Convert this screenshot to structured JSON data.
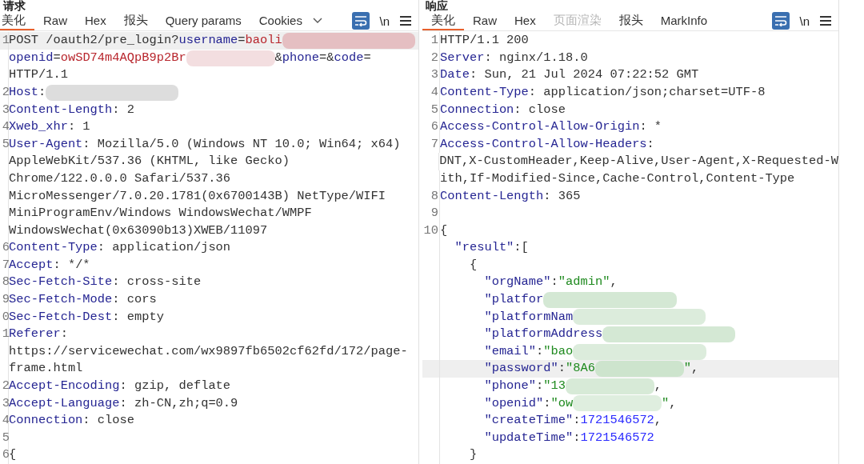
{
  "panels": [
    {
      "title": "请求",
      "tabs": [
        {
          "label": "美化",
          "selected": true,
          "disabled": false
        },
        {
          "label": "Raw",
          "selected": false,
          "disabled": false
        },
        {
          "label": "Hex",
          "selected": false,
          "disabled": false
        },
        {
          "label": "报头",
          "selected": false,
          "disabled": false
        },
        {
          "label": "Query params",
          "selected": false,
          "disabled": false
        },
        {
          "label": "Cookies",
          "selected": false,
          "disabled": false
        }
      ],
      "more_tabs": true,
      "tools": {
        "wrap_selected": true,
        "newline": "\\n"
      },
      "lines": [
        {
          "num": "1",
          "highlighted": true,
          "segments": [
            {
              "kind": "plain",
              "text": "POST /oauth2/pre_login?"
            },
            {
              "kind": "key",
              "text": "username"
            },
            {
              "kind": "plain",
              "text": "="
            },
            {
              "kind": "value",
              "text": "baoli"
            },
            {
              "kind": "redacted",
              "color": "#e3b9bd"
            }
          ]
        },
        {
          "highlighted": false,
          "segments": [
            {
              "kind": "key",
              "text": "openid"
            },
            {
              "kind": "plain",
              "text": "="
            },
            {
              "kind": "value",
              "text": "owSD74m4AQpB9p2Br"
            },
            {
              "kind": "redacted",
              "color": "#f2dadd"
            },
            {
              "kind": "plain",
              "text": "&"
            },
            {
              "kind": "key",
              "text": "phone"
            },
            {
              "kind": "plain",
              "text": "=&"
            },
            {
              "kind": "key",
              "text": "code"
            },
            {
              "kind": "plain",
              "text": "="
            }
          ]
        },
        {
          "highlighted": false,
          "segments": [
            {
              "kind": "plain",
              "text": "HTTP/1.1"
            }
          ]
        },
        {
          "num": "2",
          "highlighted": false,
          "segments": [
            {
              "kind": "key",
              "text": "Host"
            },
            {
              "kind": "plain",
              "text": ":"
            },
            {
              "kind": "redacted",
              "color": "#d9d9d9"
            }
          ]
        },
        {
          "num": "3",
          "highlighted": false,
          "segments": [
            {
              "kind": "key",
              "text": "Content-Length"
            },
            {
              "kind": "plain",
              "text": ": 2"
            }
          ]
        },
        {
          "num": "4",
          "highlighted": false,
          "segments": [
            {
              "kind": "key",
              "text": "Xweb_xhr"
            },
            {
              "kind": "plain",
              "text": ": 1"
            }
          ]
        },
        {
          "num": "5",
          "highlighted": false,
          "segments": [
            {
              "kind": "key",
              "text": "User-Agent"
            },
            {
              "kind": "plain",
              "text": ": Mozilla/5.0 (Windows NT 10.0; Win64; x64)"
            }
          ]
        },
        {
          "highlighted": false,
          "segments": [
            {
              "kind": "plain",
              "text": "AppleWebKit/537.36 (KHTML, like Gecko)"
            }
          ]
        },
        {
          "highlighted": false,
          "segments": [
            {
              "kind": "plain",
              "text": "Chrome/122.0.0.0 Safari/537.36"
            }
          ]
        },
        {
          "highlighted": false,
          "segments": [
            {
              "kind": "plain",
              "text": "MicroMessenger/7.0.20.1781(0x6700143B) NetType/WIFI"
            }
          ]
        },
        {
          "highlighted": false,
          "segments": [
            {
              "kind": "plain",
              "text": "MiniProgramEnv/Windows WindowsWechat/WMPF"
            }
          ]
        },
        {
          "highlighted": false,
          "segments": [
            {
              "kind": "plain",
              "text": "WindowsWechat(0x63090b13)XWEB/11097"
            }
          ]
        },
        {
          "num": "6",
          "highlighted": false,
          "segments": [
            {
              "kind": "key",
              "text": "Content-Type"
            },
            {
              "kind": "plain",
              "text": ": application/json"
            }
          ]
        },
        {
          "num": "7",
          "highlighted": false,
          "segments": [
            {
              "kind": "key",
              "text": "Accept"
            },
            {
              "kind": "plain",
              "text": ": */*"
            }
          ]
        },
        {
          "num": "8",
          "highlighted": false,
          "segments": [
            {
              "kind": "key",
              "text": "Sec-Fetch-Site"
            },
            {
              "kind": "plain",
              "text": ": cross-site"
            }
          ]
        },
        {
          "num": "9",
          "highlighted": false,
          "segments": [
            {
              "kind": "key",
              "text": "Sec-Fetch-Mode"
            },
            {
              "kind": "plain",
              "text": ": cors"
            }
          ]
        },
        {
          "num": "0",
          "highlighted": false,
          "segments": [
            {
              "kind": "key",
              "text": "Sec-Fetch-Dest"
            },
            {
              "kind": "plain",
              "text": ": empty"
            }
          ]
        },
        {
          "num": "1",
          "highlighted": false,
          "segments": [
            {
              "kind": "key",
              "text": "Referer"
            },
            {
              "kind": "plain",
              "text": ":"
            }
          ]
        },
        {
          "highlighted": false,
          "segments": [
            {
              "kind": "plain",
              "text": "https://servicewechat.com/wx9897fb6502cf62fd/172/page-"
            }
          ]
        },
        {
          "highlighted": false,
          "segments": [
            {
              "kind": "plain",
              "text": "frame.html"
            }
          ]
        },
        {
          "num": "2",
          "highlighted": false,
          "segments": [
            {
              "kind": "key",
              "text": "Accept-Encoding"
            },
            {
              "kind": "plain",
              "text": ": gzip, deflate"
            }
          ]
        },
        {
          "num": "3",
          "highlighted": false,
          "segments": [
            {
              "kind": "key",
              "text": "Accept-Language"
            },
            {
              "kind": "plain",
              "text": ": zh-CN,zh;q=0.9"
            }
          ]
        },
        {
          "num": "4",
          "highlighted": false,
          "segments": [
            {
              "kind": "key",
              "text": "Connection"
            },
            {
              "kind": "plain",
              "text": ": close"
            }
          ]
        },
        {
          "num": "5",
          "highlighted": false
        },
        {
          "num": "6",
          "highlighted": false,
          "segments": [
            {
              "kind": "plain",
              "text": "{"
            }
          ]
        }
      ]
    },
    {
      "title": "响应",
      "tabs": [
        {
          "label": "美化",
          "selected": true,
          "disabled": false
        },
        {
          "label": "Raw",
          "selected": false,
          "disabled": false
        },
        {
          "label": "Hex",
          "selected": false,
          "disabled": false
        },
        {
          "label": "页面渲染",
          "selected": false,
          "disabled": true
        },
        {
          "label": "报头",
          "selected": false,
          "disabled": false
        },
        {
          "label": "MarkInfo",
          "selected": false,
          "disabled": false
        }
      ],
      "more_tabs": false,
      "tools": {
        "wrap_selected": true,
        "newline": "\\n"
      },
      "lines": [
        {
          "num": "1",
          "highlighted": false,
          "segments": [
            {
              "kind": "plain",
              "text": "HTTP/1.1 200"
            }
          ]
        },
        {
          "num": "2",
          "highlighted": false,
          "segments": [
            {
              "kind": "key",
              "text": "Server"
            },
            {
              "kind": "plain",
              "text": ": nginx/1.18.0"
            }
          ]
        },
        {
          "num": "3",
          "highlighted": false,
          "segments": [
            {
              "kind": "key",
              "text": "Date"
            },
            {
              "kind": "plain",
              "text": ": Sun, 21 Jul 2024 07:22:52 GMT"
            }
          ]
        },
        {
          "num": "4",
          "highlighted": false,
          "segments": [
            {
              "kind": "key",
              "text": "Content-Type"
            },
            {
              "kind": "plain",
              "text": ": application/json;charset=UTF-8"
            }
          ]
        },
        {
          "num": "5",
          "highlighted": false,
          "segments": [
            {
              "kind": "key",
              "text": "Connection"
            },
            {
              "kind": "plain",
              "text": ": close"
            }
          ]
        },
        {
          "num": "6",
          "highlighted": false,
          "segments": [
            {
              "kind": "key",
              "text": "Access-Control-Allow-Origin"
            },
            {
              "kind": "plain",
              "text": ": *"
            }
          ]
        },
        {
          "num": "7",
          "highlighted": false,
          "segments": [
            {
              "kind": "key",
              "text": "Access-Control-Allow-Headers"
            },
            {
              "kind": "plain",
              "text": ":"
            }
          ]
        },
        {
          "highlighted": false,
          "segments": [
            {
              "kind": "plain",
              "text": "DNT,X-CustomHeader,Keep-Alive,User-Agent,X-Requested-W"
            }
          ]
        },
        {
          "highlighted": false,
          "segments": [
            {
              "kind": "plain",
              "text": "ith,If-Modified-Since,Cache-Control,Content-Type"
            }
          ]
        },
        {
          "num": "8",
          "highlighted": false,
          "segments": [
            {
              "kind": "key",
              "text": "Content-Length"
            },
            {
              "kind": "plain",
              "text": ": 365"
            }
          ]
        },
        {
          "num": "9",
          "highlighted": false
        },
        {
          "num": "10",
          "highlighted": false,
          "segments": [
            {
              "kind": "plain",
              "text": "{"
            }
          ]
        },
        {
          "highlighted": false,
          "kind": "depth1",
          "segments": [
            {
              "kind": "key",
              "text": "\"result\""
            },
            {
              "kind": "plain",
              "text": ":["
            }
          ]
        },
        {
          "highlighted": false,
          "kind": "depth2",
          "segments": [
            {
              "kind": "plain",
              "text": "{"
            }
          ]
        },
        {
          "highlighted": false,
          "kind": "depth3",
          "segments": [
            {
              "kind": "key",
              "text": "\"orgName\""
            },
            {
              "kind": "plain",
              "text": ":"
            },
            {
              "kind": "string",
              "text": "\"admin\""
            },
            {
              "kind": "plain",
              "text": ","
            }
          ]
        },
        {
          "highlighted": false,
          "kind": "depth3",
          "segments": [
            {
              "kind": "key",
              "text": "\"platfor"
            },
            {
              "kind": "redacted",
              "color": "#cfe5cf"
            }
          ]
        },
        {
          "highlighted": false,
          "kind": "depth3",
          "segments": [
            {
              "kind": "key",
              "text": "\"platformNam"
            },
            {
              "kind": "redacted",
              "color": "#d8ead8"
            }
          ]
        },
        {
          "highlighted": false,
          "kind": "depth3",
          "segments": [
            {
              "kind": "key",
              "text": "\"platformAddress"
            },
            {
              "kind": "redacted",
              "color": "#cfe5cf"
            }
          ]
        },
        {
          "highlighted": false,
          "kind": "depth3",
          "segments": [
            {
              "kind": "key",
              "text": "\"email\""
            },
            {
              "kind": "plain",
              "text": ":"
            },
            {
              "kind": "string",
              "text": "\"bao"
            },
            {
              "kind": "redacted",
              "color": "#d8ead8"
            }
          ]
        },
        {
          "highlighted": true,
          "kind": "depth3",
          "segments": [
            {
              "kind": "key",
              "text": "\"password\""
            },
            {
              "kind": "plain",
              "text": ":"
            },
            {
              "kind": "string",
              "text": "\"8A6"
            },
            {
              "kind": "redacted",
              "color": "#c9e2c9"
            },
            {
              "kind": "string",
              "text": "\""
            },
            {
              "kind": "plain",
              "text": ","
            }
          ]
        },
        {
          "highlighted": false,
          "kind": "depth3",
          "segments": [
            {
              "kind": "key",
              "text": "\"phone\""
            },
            {
              "kind": "plain",
              "text": ":"
            },
            {
              "kind": "string",
              "text": "\"13"
            },
            {
              "kind": "redacted",
              "color": "#d3e8d3"
            },
            {
              "kind": "plain",
              "text": ","
            }
          ]
        },
        {
          "highlighted": false,
          "kind": "depth3",
          "segments": [
            {
              "kind": "key",
              "text": "\"openid\""
            },
            {
              "kind": "plain",
              "text": ":"
            },
            {
              "kind": "string",
              "text": "\"ow"
            },
            {
              "kind": "redacted",
              "color": "#dcecdc"
            },
            {
              "kind": "string",
              "text": "\""
            },
            {
              "kind": "plain",
              "text": ","
            }
          ]
        },
        {
          "highlighted": false,
          "kind": "depth3",
          "segments": [
            {
              "kind": "key",
              "text": "\"createTime\""
            },
            {
              "kind": "plain",
              "text": ":"
            },
            {
              "kind": "number",
              "text": "1721546572"
            },
            {
              "kind": "plain",
              "text": ","
            }
          ]
        },
        {
          "highlighted": false,
          "kind": "depth3",
          "segments": [
            {
              "kind": "key",
              "text": "\"updateTime\""
            },
            {
              "kind": "plain",
              "text": ":"
            },
            {
              "kind": "number",
              "text": "1721546572"
            }
          ]
        },
        {
          "highlighted": false,
          "kind": "depth2",
          "segments": [
            {
              "kind": "plain",
              "text": "}"
            }
          ]
        }
      ]
    }
  ]
}
